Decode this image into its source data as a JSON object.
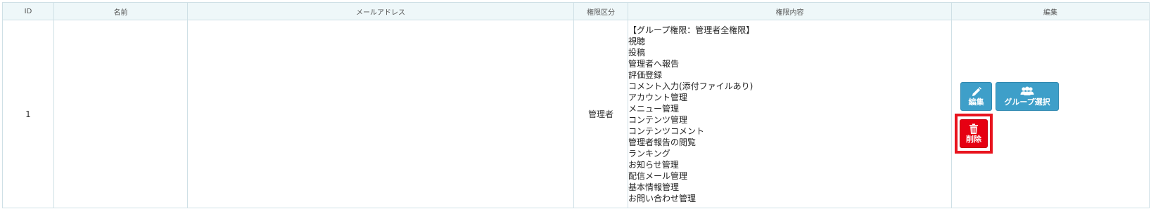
{
  "table": {
    "headers": {
      "id": "ID",
      "name": "名前",
      "email": "メールアドレス",
      "role_type": "権限区分",
      "permissions": "権限内容",
      "edit": "編集"
    },
    "rows": [
      {
        "id": "1",
        "name": "",
        "email": "",
        "role_type": "管理者",
        "permissions": [
          "【グループ権限：管理者全権限】",
          "視聴",
          "投稿",
          "管理者へ報告",
          "評価登録",
          "コメント入力(添付ファイルあり)",
          "アカウント管理",
          "メニュー管理",
          "コンテンツ管理",
          "コンテンツコメント",
          "管理者報告の閲覧",
          "ランキング",
          "お知らせ管理",
          "配信メール管理",
          "基本情報管理",
          "お問い合わせ管理"
        ],
        "actions": {
          "edit_label": "編集",
          "group_select_label": "グループ選択",
          "delete_label": "削除"
        }
      }
    ]
  },
  "icons": {
    "edit": "pencil-icon",
    "group_select": "users-icon",
    "delete": "trash-icon"
  },
  "colors": {
    "header_bg": "#eef7f9",
    "border": "#cfe0e6",
    "primary_button": "#3e9fc9",
    "delete_button": "#e60012",
    "highlight_box": "#e8141e"
  }
}
